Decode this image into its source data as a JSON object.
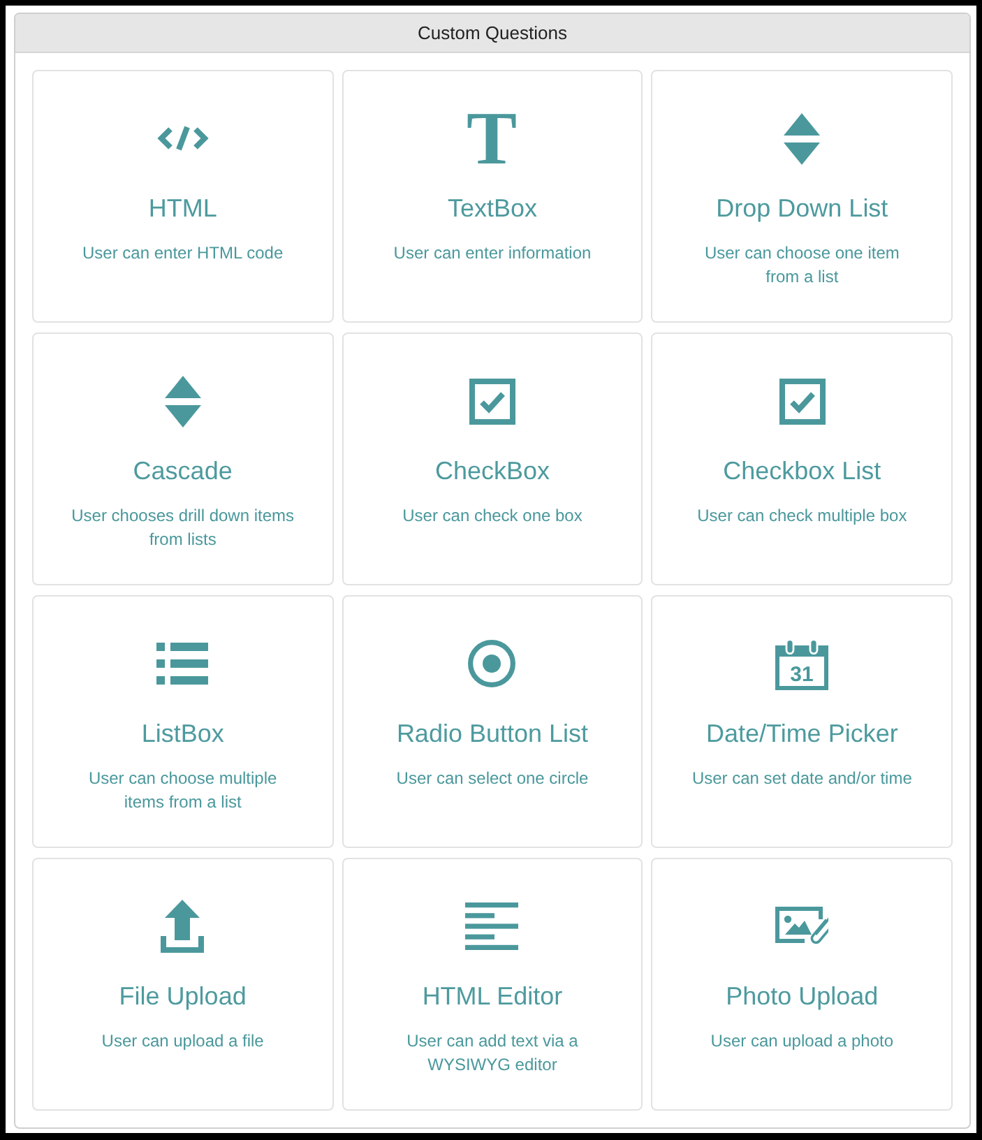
{
  "panel": {
    "title": "Custom Questions"
  },
  "question_types": [
    {
      "kind": "html",
      "title": "HTML",
      "description": "User can enter HTML code"
    },
    {
      "kind": "textbox",
      "icon_text": "T",
      "title": "TextBox",
      "description": "User can enter information"
    },
    {
      "kind": "dropdown",
      "title": "Drop Down List",
      "description": "User can choose one item\nfrom a list"
    },
    {
      "kind": "cascade",
      "title": "Cascade",
      "description": "User chooses drill down items\nfrom lists"
    },
    {
      "kind": "checkbox",
      "title": "CheckBox",
      "description": "User can check one box"
    },
    {
      "kind": "checkbox_list",
      "title": "Checkbox List",
      "description": "User can check multiple box"
    },
    {
      "kind": "listbox",
      "title": "ListBox",
      "description": "User can choose multiple\nitems from a list"
    },
    {
      "kind": "radio_list",
      "title": "Radio Button List",
      "description": "User can select one circle"
    },
    {
      "kind": "datetime",
      "icon_text": "31",
      "title": "Date/Time Picker",
      "description": "User can set date and/or time"
    },
    {
      "kind": "file_upload",
      "title": "File Upload",
      "description": "User can upload a file"
    },
    {
      "kind": "html_editor",
      "title": "HTML Editor",
      "description": "User can add text via a\nWYSIWYG editor"
    },
    {
      "kind": "photo_upload",
      "title": "Photo Upload",
      "description": "User can upload a photo"
    }
  ]
}
